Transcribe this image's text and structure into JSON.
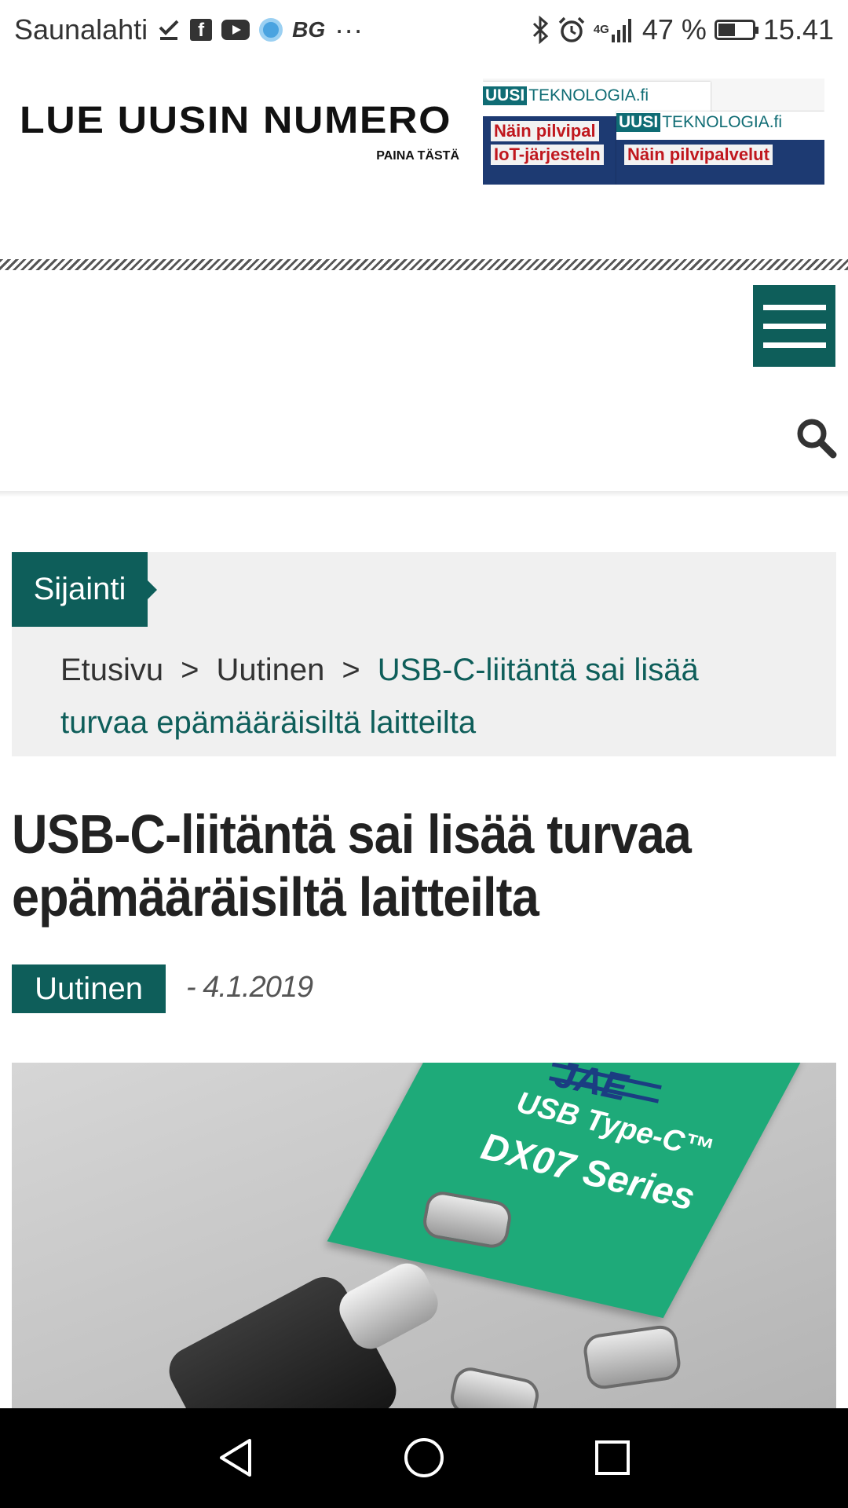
{
  "status_bar": {
    "carrier": "Saunalahti",
    "bg_label": "BG",
    "more": "···",
    "network": "4G",
    "battery_percent": "47 %",
    "battery_level": 0.47,
    "time": "15.41"
  },
  "banner": {
    "title": "LUE UUSIN NUMERO",
    "subtitle": "PAINA TÄSTÄ",
    "magazine_brand_1": "UUSI",
    "magazine_brand_2": "TEKNOLOGIA.fi",
    "cover_headline_1": "Näin pilvipal",
    "cover_headline_2": "IoT-järjesteln",
    "cover_headline_3": "Näin pilvipalvelut"
  },
  "breadcrumb": {
    "label": "Sijainti",
    "home": "Etusivu",
    "separator": ">",
    "section": "Uutinen",
    "current": "USB-C-liitäntä sai lisää turvaa epämääräisiltä laitteilta"
  },
  "article": {
    "title": "USB-C-liitäntä sai lisää turvaa epämääräisiltä laitteilta",
    "category": "Uutinen",
    "date": "- 4.1.2019"
  },
  "hero_image": {
    "brand": "JAE",
    "line1": "USB Type-C™",
    "line2": "DX07 Series"
  },
  "colors": {
    "accent": "#0e5e5a",
    "crumb_bg": "#f0f0f0"
  },
  "icons": {
    "menu": "hamburger-menu-icon",
    "search": "search-icon",
    "back": "back-triangle-icon",
    "home": "home-circle-icon",
    "recents": "recents-square-icon"
  }
}
